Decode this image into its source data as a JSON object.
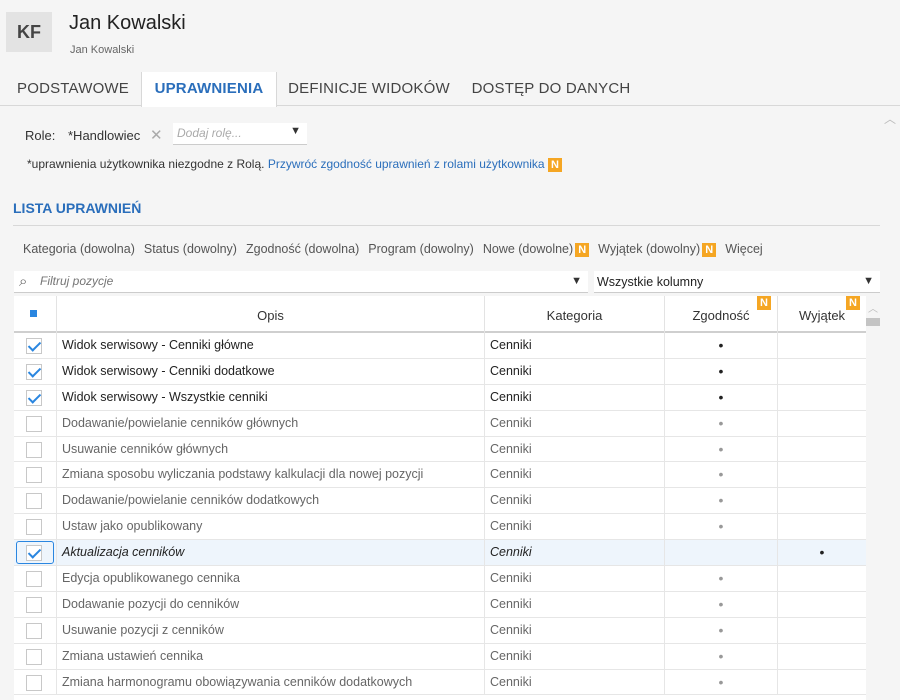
{
  "header": {
    "initials": "KF",
    "name": "Jan Kowalski",
    "subtitle": "Jan Kowalski"
  },
  "tabs": [
    {
      "label": "PODSTAWOWE",
      "active": false
    },
    {
      "label": "UPRAWNIENIA",
      "active": true
    },
    {
      "label": "DEFINICJE WIDOKÓW",
      "active": false
    },
    {
      "label": "DOSTĘP DO DANYCH",
      "active": false
    }
  ],
  "roles": {
    "label": "Role:",
    "chip": "*Handlowiec",
    "placeholder": "Dodaj rolę...",
    "note": "*uprawnienia użytkownika niezgodne z Rolą.",
    "link": "Przywróć zgodność uprawnień z rolami użytkownika",
    "badge": "N"
  },
  "section": {
    "title": "LISTA UPRAWNIEŃ"
  },
  "filters": [
    {
      "label": "Kategoria (dowolna)",
      "badge": ""
    },
    {
      "label": "Status (dowolny)",
      "badge": ""
    },
    {
      "label": "Zgodność (dowolna)",
      "badge": ""
    },
    {
      "label": "Program (dowolny)",
      "badge": ""
    },
    {
      "label": "Nowe (dowolne)",
      "badge": "N"
    },
    {
      "label": "Wyjątek (dowolny)",
      "badge": "N"
    },
    {
      "label": "Więcej",
      "badge": ""
    }
  ],
  "search": {
    "placeholder": "Filtruj pozycje",
    "columns_value": "Wszystkie kolumny"
  },
  "table": {
    "columns": {
      "opis": "Opis",
      "kategoria": "Kategoria",
      "zgodnosc": "Zgodność",
      "wyjatek": "Wyjątek",
      "badge": "N"
    },
    "rows": [
      {
        "opis": "Widok serwisowy - Cenniki główne",
        "kategoria": "Cenniki",
        "checked": true,
        "zgodnosc": "•",
        "wyjatek": "",
        "italic": false
      },
      {
        "opis": "Widok serwisowy - Cenniki dodatkowe",
        "kategoria": "Cenniki",
        "checked": true,
        "zgodnosc": "•",
        "wyjatek": "",
        "italic": false
      },
      {
        "opis": "Widok serwisowy - Wszystkie cenniki",
        "kategoria": "Cenniki",
        "checked": true,
        "zgodnosc": "•",
        "wyjatek": "",
        "italic": false
      },
      {
        "opis": "Dodawanie/powielanie cenników głównych",
        "kategoria": "Cenniki",
        "checked": false,
        "zgodnosc": "•",
        "wyjatek": "",
        "italic": false
      },
      {
        "opis": "Usuwanie cenników głównych",
        "kategoria": "Cenniki",
        "checked": false,
        "zgodnosc": "•",
        "wyjatek": "",
        "italic": false
      },
      {
        "opis": "Zmiana sposobu wyliczania podstawy kalkulacji dla nowej pozycji",
        "kategoria": "Cenniki",
        "checked": false,
        "zgodnosc": "•",
        "wyjatek": "",
        "italic": false
      },
      {
        "opis": "Dodawanie/powielanie cenników dodatkowych",
        "kategoria": "Cenniki",
        "checked": false,
        "zgodnosc": "•",
        "wyjatek": "",
        "italic": false
      },
      {
        "opis": "Ustaw jako opublikowany",
        "kategoria": "Cenniki",
        "checked": false,
        "zgodnosc": "•",
        "wyjatek": "",
        "italic": false
      },
      {
        "opis": "Aktualizacja cenników",
        "kategoria": "Cenniki",
        "checked": true,
        "zgodnosc": "",
        "wyjatek": "•",
        "italic": true
      },
      {
        "opis": "Edycja opublikowanego cennika",
        "kategoria": "Cenniki",
        "checked": false,
        "zgodnosc": "•",
        "wyjatek": "",
        "italic": false
      },
      {
        "opis": "Dodawanie pozycji do cenników",
        "kategoria": "Cenniki",
        "checked": false,
        "zgodnosc": "•",
        "wyjatek": "",
        "italic": false
      },
      {
        "opis": "Usuwanie pozycji z cenników",
        "kategoria": "Cenniki",
        "checked": false,
        "zgodnosc": "•",
        "wyjatek": "",
        "italic": false
      },
      {
        "opis": "Zmiana ustawień cennika",
        "kategoria": "Cenniki",
        "checked": false,
        "zgodnosc": "•",
        "wyjatek": "",
        "italic": false
      },
      {
        "opis": "Zmiana harmonogramu obowiązywania cenników dodatkowych",
        "kategoria": "Cenniki",
        "checked": false,
        "zgodnosc": "•",
        "wyjatek": "",
        "italic": false
      }
    ]
  },
  "colors": {
    "accent": "#2a6ebb",
    "badge": "#f5a623",
    "check": "#2a86e0"
  }
}
